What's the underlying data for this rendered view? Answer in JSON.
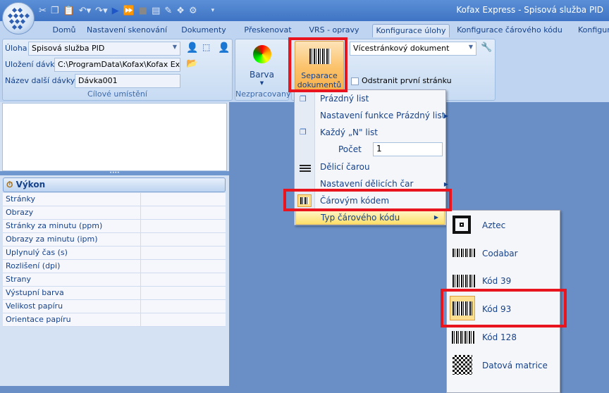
{
  "window": {
    "title": "Kofax Express - Spisová služba PID"
  },
  "tabs": [
    "Domů",
    "Nastavení skenování",
    "Dokumenty",
    "Přeskenovat",
    "VRS - opravy",
    "Konfigurace úlohy",
    "Konfigurace čárového kódu",
    "Konfigura"
  ],
  "active_tab": "Konfigurace úlohy",
  "ribbon": {
    "destination": {
      "task_label": "Úloha",
      "task_value": "Spisová služba PID",
      "batch_path_label": "Uložení dávky",
      "batch_path_value": "C:\\ProgramData\\Kofax\\Kofax Ex...",
      "next_batch_label": "Název další dávky",
      "next_batch_value": "Dávka001",
      "group_label": "Cílové umístění"
    },
    "raw": {
      "color_label": "Barva",
      "group_label": "Nezpracovaný"
    },
    "separation": {
      "button_line1": "Separace",
      "button_line2": "dokumentů",
      "doc_type_value": "Vícestránkový dokument",
      "remove_first_page_label": "Odstranit první stránku"
    }
  },
  "menu": {
    "items": [
      "Prázdný list",
      "Nastavení funkce Prázdný list",
      "Každý „N\" list",
      "Počet",
      "Dělicí čarou",
      "Nastavení dělicích čar",
      "Čárovým kódem",
      "Typ čárového kódu"
    ],
    "count_value": "1"
  },
  "submenu": {
    "items": [
      "Aztec",
      "Codabar",
      "Kód 39",
      "Kód 93",
      "Kód 128",
      "Datová matrice"
    ],
    "selected": "Kód 93"
  },
  "performance": {
    "title": "Výkon",
    "rows": [
      "Stránky",
      "Obrazy",
      "Stránky za minutu (ppm)",
      "Obrazy za minutu (ipm)",
      "Uplynulý čas (s)",
      "Rozlišení (dpi)",
      "Strany",
      "Výstupní barva",
      "Velikost papíru",
      "Orientace papíru"
    ]
  }
}
